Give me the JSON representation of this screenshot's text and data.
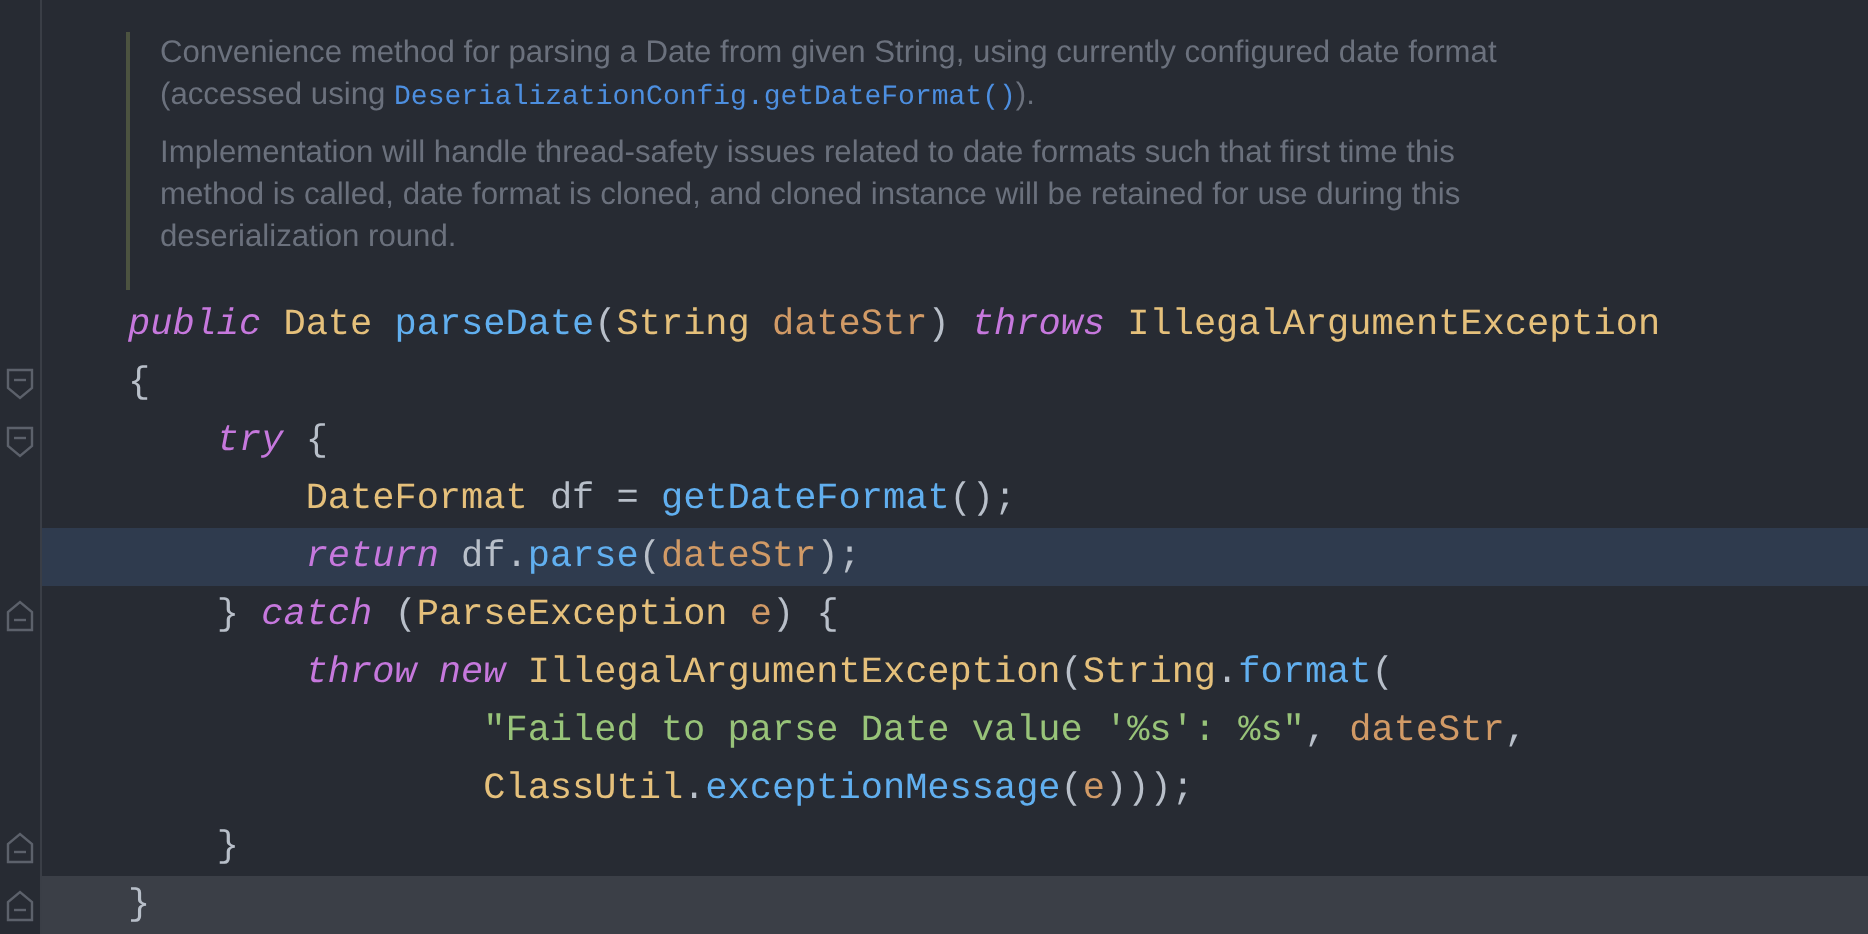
{
  "doc_comment": {
    "paragraphs": [
      {
        "lines": [
          [
            {
              "kind": "text",
              "text": "Convenience method for parsing a Date from given String, using currently configured date format"
            }
          ],
          [
            {
              "kind": "text",
              "text": "(accessed using "
            },
            {
              "kind": "code",
              "text": "DeserializationConfig.getDateFormat()"
            },
            {
              "kind": "text",
              "text": ")."
            }
          ]
        ]
      },
      {
        "lines": [
          [
            {
              "kind": "text",
              "text": "Implementation will handle thread-safety issues related to date formats such that first time this"
            }
          ],
          [
            {
              "kind": "text",
              "text": "method is called, date format is cloned, and cloned instance will be retained for use during this"
            }
          ],
          [
            {
              "kind": "text",
              "text": "deserialization round."
            }
          ]
        ]
      }
    ]
  },
  "code_lines": [
    {
      "tokens": [
        {
          "kind": "keyword",
          "text": "public "
        },
        {
          "kind": "type",
          "text": "Date "
        },
        {
          "kind": "method",
          "text": "parseDate"
        },
        {
          "kind": "plain",
          "text": "("
        },
        {
          "kind": "type",
          "text": "String "
        },
        {
          "kind": "param",
          "text": "dateStr"
        },
        {
          "kind": "plain",
          "text": ") "
        },
        {
          "kind": "keyword",
          "text": "throws "
        },
        {
          "kind": "type",
          "text": "IllegalArgumentException"
        }
      ]
    },
    {
      "fold_start": true,
      "tokens": [
        {
          "kind": "plain",
          "text": "{"
        }
      ]
    },
    {
      "fold_start": true,
      "tokens": [
        {
          "kind": "keyword",
          "text": "    try"
        },
        {
          "kind": "plain",
          "text": " {"
        }
      ]
    },
    {
      "tokens": [
        {
          "kind": "type",
          "text": "        DateFormat"
        },
        {
          "kind": "plain",
          "text": " df = "
        },
        {
          "kind": "method",
          "text": "getDateFormat"
        },
        {
          "kind": "plain",
          "text": "();"
        }
      ]
    },
    {
      "current": true,
      "tokens": [
        {
          "kind": "keyword",
          "text": "        return"
        },
        {
          "kind": "plain",
          "text": " df."
        },
        {
          "kind": "method",
          "text": "parse"
        },
        {
          "kind": "plain",
          "text": "("
        },
        {
          "kind": "param",
          "text": "dateStr"
        },
        {
          "kind": "plain",
          "text": ");"
        }
      ]
    },
    {
      "fold_end": true,
      "tokens": [
        {
          "kind": "plain",
          "text": "    } "
        },
        {
          "kind": "keyword",
          "text": "catch"
        },
        {
          "kind": "plain",
          "text": " ("
        },
        {
          "kind": "type",
          "text": "ParseException "
        },
        {
          "kind": "param",
          "text": "e"
        },
        {
          "kind": "plain",
          "text": ") {"
        }
      ]
    },
    {
      "tokens": [
        {
          "kind": "keyword",
          "text": "        throw new "
        },
        {
          "kind": "type",
          "text": "IllegalArgumentException"
        },
        {
          "kind": "plain",
          "text": "("
        },
        {
          "kind": "type",
          "text": "String"
        },
        {
          "kind": "plain",
          "text": "."
        },
        {
          "kind": "method",
          "text": "format"
        },
        {
          "kind": "plain",
          "text": "("
        }
      ]
    },
    {
      "tokens": [
        {
          "kind": "string",
          "text": "                \"Failed to parse Date value '%s': %s\""
        },
        {
          "kind": "plain",
          "text": ", "
        },
        {
          "kind": "param",
          "text": "dateStr"
        },
        {
          "kind": "plain",
          "text": ","
        }
      ]
    },
    {
      "tokens": [
        {
          "kind": "type",
          "text": "                ClassUtil"
        },
        {
          "kind": "plain",
          "text": "."
        },
        {
          "kind": "method",
          "text": "exceptionMessage"
        },
        {
          "kind": "plain",
          "text": "("
        },
        {
          "kind": "param",
          "text": "e"
        },
        {
          "kind": "plain",
          "text": ")));"
        }
      ]
    },
    {
      "fold_end": true,
      "tokens": [
        {
          "kind": "plain",
          "text": "    }"
        }
      ]
    },
    {
      "fold_end": true,
      "hovered": true,
      "tokens": [
        {
          "kind": "plain",
          "text": "}"
        }
      ]
    }
  ]
}
